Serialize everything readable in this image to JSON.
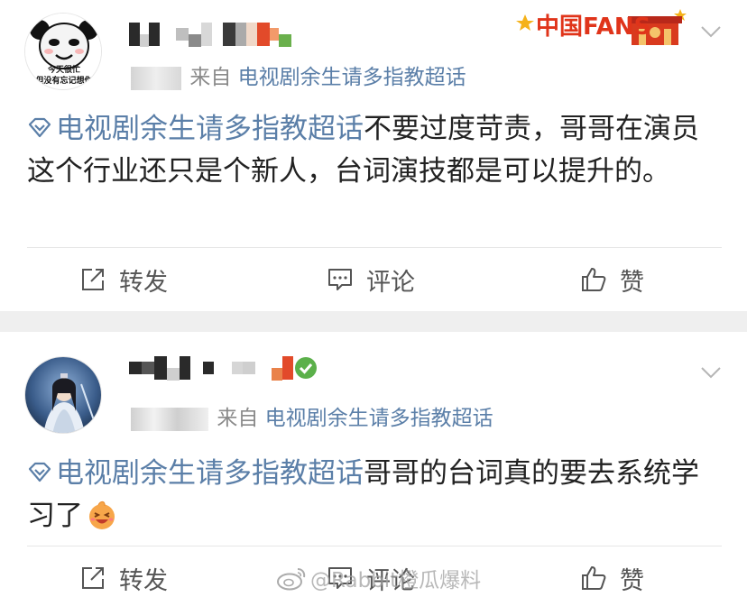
{
  "colors": {
    "topic": "#5b7fa8",
    "text": "#222222",
    "meta": "#8a8a8a",
    "band": "#efefef",
    "action": "#555555"
  },
  "posts": [
    {
      "avatar": {
        "icon": "panda-meme-avatar",
        "caption_line1": "今天很忙",
        "caption_line2": "但没有忘记想你"
      },
      "badge": {
        "text": "中国FANS",
        "icon": "china-fans-badge"
      },
      "meta_time": "刚刚",
      "meta_from": "来自",
      "meta_topic": "电视剧余生请多指教超话",
      "content_topic": "电视剧余生请多指教超话",
      "content_text": "不要过度苛责，哥哥在演员这个行业还只是个新人，台词演技都是可以提升的。",
      "actions": {
        "repost": "转发",
        "comment": "评论",
        "like": "赞"
      }
    },
    {
      "avatar": {
        "icon": "costume-character-avatar"
      },
      "meta_time": "",
      "meta_from": "来自",
      "meta_topic": "电视剧余生请多指教超话",
      "content_topic": "电视剧余生请多指教超话",
      "content_text": "哥哥的台词真的要去系统学习了",
      "emoji": "laughing-emoji",
      "actions": {
        "repost": "转发",
        "comment": "评论",
        "like": "赞"
      }
    }
  ],
  "watermark": {
    "text": "@Rabbit橙瓜爆料",
    "icon": "weibo-logo"
  }
}
